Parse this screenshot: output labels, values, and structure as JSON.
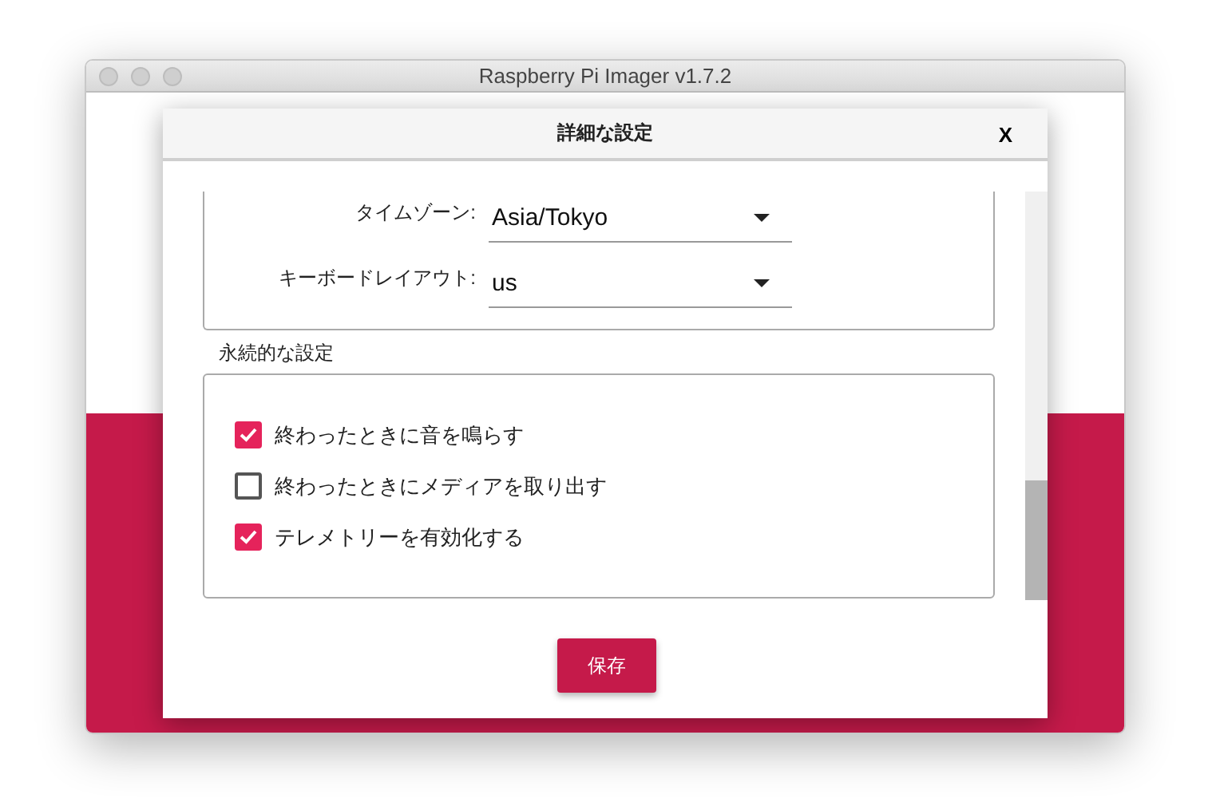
{
  "window": {
    "title": "Raspberry Pi Imager v1.7.2"
  },
  "dialog": {
    "title": "詳細な設定",
    "close": "X",
    "locale_fields": [
      {
        "label": "タイムゾーン:",
        "value": "Asia/Tokyo"
      },
      {
        "label": "キーボードレイアウト:",
        "value": "us"
      }
    ],
    "persistent_section": {
      "title": "永続的な設定",
      "options": [
        {
          "label": "終わったときに音を鳴らす",
          "checked": true
        },
        {
          "label": "終わったときにメディアを取り出す",
          "checked": false
        },
        {
          "label": "テレメトリーを有効化する",
          "checked": true
        }
      ]
    },
    "save_button": "保存"
  }
}
